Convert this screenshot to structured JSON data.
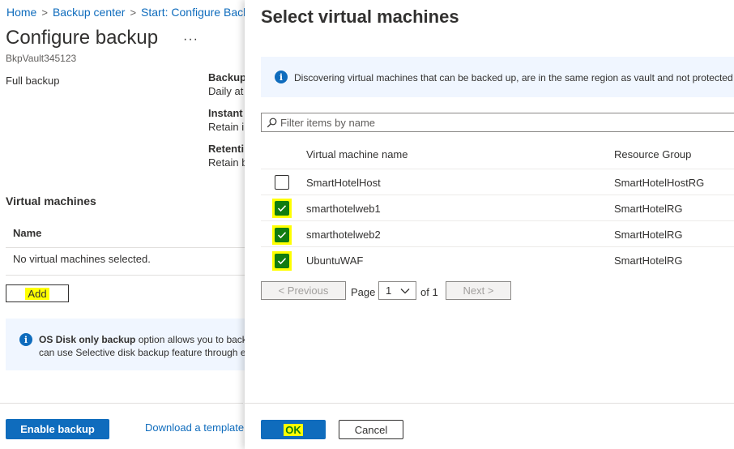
{
  "breadcrumb": {
    "items": [
      "Home",
      "Backup center",
      "Start: Configure Back"
    ]
  },
  "page": {
    "title": "Configure backup",
    "more_label": "···",
    "subtitle": "BkpVault345123",
    "policy_name": "Full backup",
    "summary": [
      {
        "heading": "Backup",
        "value": "Daily at"
      },
      {
        "heading": "Instant",
        "value": "Retain in"
      },
      {
        "heading": "Retenti",
        "value": "Retain b"
      }
    ],
    "vm_section_title": "Virtual machines",
    "vm_table_header": "Name",
    "vm_empty_text": "No virtual machines selected.",
    "add_label": "Add",
    "info_bold": "OS Disk only backup",
    "info_line1": " option allows you to back",
    "info_line2": "can use Selective disk backup feature through e",
    "enable_label": "Enable backup",
    "download_label": "Download a template"
  },
  "blade": {
    "title": "Select virtual machines",
    "info_text": "Discovering virtual machines that can be backed up, are in the same region as vault and not protected",
    "filter_placeholder": "Filter items by name",
    "columns": {
      "name": "Virtual machine name",
      "rg": "Resource Group"
    },
    "rows": [
      {
        "name": "SmartHotelHost",
        "rg": "SmartHotelHostRG",
        "checked": false
      },
      {
        "name": "smarthotelweb1",
        "rg": "SmartHotelRG",
        "checked": true
      },
      {
        "name": "smarthotelweb2",
        "rg": "SmartHotelRG",
        "checked": true
      },
      {
        "name": "UbuntuWAF",
        "rg": "SmartHotelRG",
        "checked": true
      }
    ],
    "pagination": {
      "previous_label": "< Previous",
      "page_label": "Page",
      "current_page": "1",
      "of_label": "of 1",
      "next_label": "Next >"
    },
    "ok_label": "OK",
    "cancel_label": "Cancel"
  },
  "colors": {
    "accent": "#0f6cbd",
    "check": "#107c10",
    "highlight": "#ffff00"
  }
}
